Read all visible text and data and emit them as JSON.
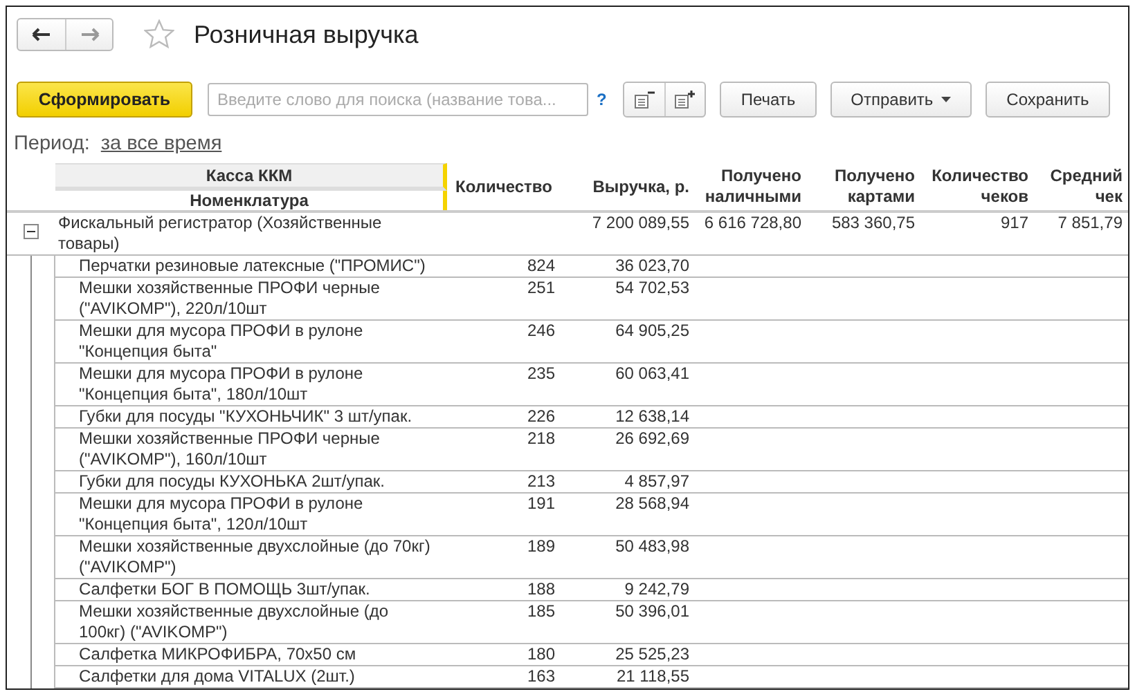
{
  "window": {
    "title": "Розничная выручка",
    "favorite": false
  },
  "toolbar": {
    "generate_button": "Сформировать",
    "search": {
      "placeholder": "Введите слово для поиска (название това..."
    },
    "help": "?",
    "buttons": [
      {
        "label": "Печать",
        "kind": "plain"
      },
      {
        "label": "Отправить",
        "kind": "dropdown"
      },
      {
        "label": "Сохранить",
        "kind": "plain"
      }
    ]
  },
  "period": {
    "label": "Период:",
    "value": "за все время"
  },
  "table": {
    "group_header": "Касса ККМ",
    "columns": [
      "Номенклатура",
      "Количество",
      "Выручка, р.",
      "Получено наличными",
      "Получено картами",
      "Количество чеков",
      "Средний чек"
    ],
    "group": {
      "name": "Фискальный регистратор (Хозяйственные товары)",
      "expanded": true,
      "cells": [
        "",
        "7 200 089,55",
        "6 616 728,80",
        "583 360,75",
        "917",
        "7 851,79"
      ]
    },
    "rows": [
      {
        "name": "Перчатки резиновые латексные (\"ПРОМИС\")",
        "quantity": "824",
        "revenue": "36 023,70"
      },
      {
        "name": "Мешки хозяйственные ПРОФИ черные (\"AVIKOMP\"), 220л/10шт",
        "quantity": "251",
        "revenue": "54 702,53"
      },
      {
        "name": "Мешки для мусора ПРОФИ в рулоне \"Концепция быта\"",
        "quantity": "246",
        "revenue": "64 905,25"
      },
      {
        "name": "Мешки для мусора ПРОФИ в рулоне \"Концепция быта\", 180л/10шт",
        "quantity": "235",
        "revenue": "60 063,41"
      },
      {
        "name": "Губки для посуды \"КУХОНЬЧИК\" 3 шт/упак.",
        "quantity": "226",
        "revenue": "12 638,14"
      },
      {
        "name": "Мешки хозяйственные ПРОФИ черные (\"AVIKOMP\"), 160л/10шт",
        "quantity": "218",
        "revenue": "26 692,69"
      },
      {
        "name": "Губки для посуды КУХОНЬКА 2шт/упак.",
        "quantity": "213",
        "revenue": "4 857,97"
      },
      {
        "name": "Мешки для мусора ПРОФИ в рулоне \"Концепция быта\", 120л/10шт",
        "quantity": "191",
        "revenue": "28 568,94"
      },
      {
        "name": "Мешки хозяйственные двухслойные (до 70кг) (\"AVIKOMP\")",
        "quantity": "189",
        "revenue": "50 483,98"
      },
      {
        "name": "Салфетки БОГ В ПОМОЩЬ 3шт/упак.",
        "quantity": "188",
        "revenue": "9 242,79"
      },
      {
        "name": "Мешки хозяйственные двухслойные (до 100кг) (\"AVIKOMP\")",
        "quantity": "185",
        "revenue": "50 396,01"
      },
      {
        "name": "Салфетка МИКРОФИБРА, 70x50 см",
        "quantity": "180",
        "revenue": "25 525,23"
      },
      {
        "name": "Салфетки для дома VITALUX (2шт.)",
        "quantity": "163",
        "revenue": "21 118,55"
      }
    ]
  }
}
